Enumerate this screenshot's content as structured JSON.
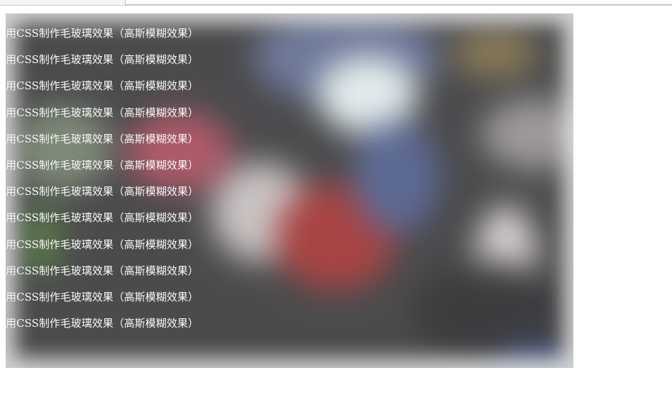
{
  "content": {
    "lines": [
      "用CSS制作毛玻璃效果（高斯模糊效果）",
      "用CSS制作毛玻璃效果（高斯模糊效果）",
      "用CSS制作毛玻璃效果（高斯模糊效果）",
      "用CSS制作毛玻璃效果（高斯模糊效果）",
      "用CSS制作毛玻璃效果（高斯模糊效果）",
      "用CSS制作毛玻璃效果（高斯模糊效果）",
      "用CSS制作毛玻璃效果（高斯模糊效果）",
      "用CSS制作毛玻璃效果（高斯模糊效果）",
      "用CSS制作毛玻璃效果（高斯模糊效果）",
      "用CSS制作毛玻璃效果（高斯模糊效果）",
      "用CSS制作毛玻璃效果（高斯模糊效果）",
      "用CSS制作毛玻璃效果（高斯模糊效果）"
    ]
  },
  "colors": {
    "text": "#ffffff",
    "background_base": "#4a4a4c",
    "page": "#ffffff"
  }
}
